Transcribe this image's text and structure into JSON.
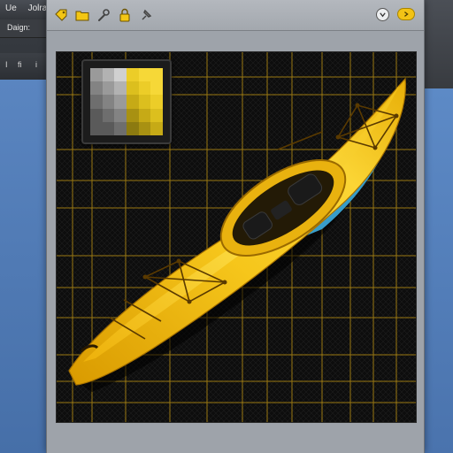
{
  "background_app": {
    "title_parts": [
      "Ue",
      "Jolrals"
    ],
    "sublabel": "Daign:",
    "toolbar_items": [
      "I",
      "fi",
      "i"
    ]
  },
  "dialog": {
    "toolbar": {
      "tools": [
        "tag-tool",
        "folder-tool",
        "wrench-tool",
        "lock-tool",
        "pin-tool"
      ],
      "help_button_icon": "chevron-down-icon",
      "action_button_icon": "chevron-down-icon"
    }
  },
  "swatches": {
    "gray": [
      "#5a5a5a",
      "#6e6e6e",
      "#838383",
      "#9a9a9a",
      "#b2b2b2",
      "#d0d0d0"
    ],
    "yellow": [
      "#8c7a10",
      "#a89112",
      "#c6aa16",
      "#dcbf1e",
      "#eccd28",
      "#f6d837"
    ]
  },
  "colors": {
    "kayak_yellow": "#f4c21a",
    "grid_line": "#b28a12",
    "canvas_bg": "#0b0b0b",
    "dialog_bg": "#9ea3aa"
  }
}
